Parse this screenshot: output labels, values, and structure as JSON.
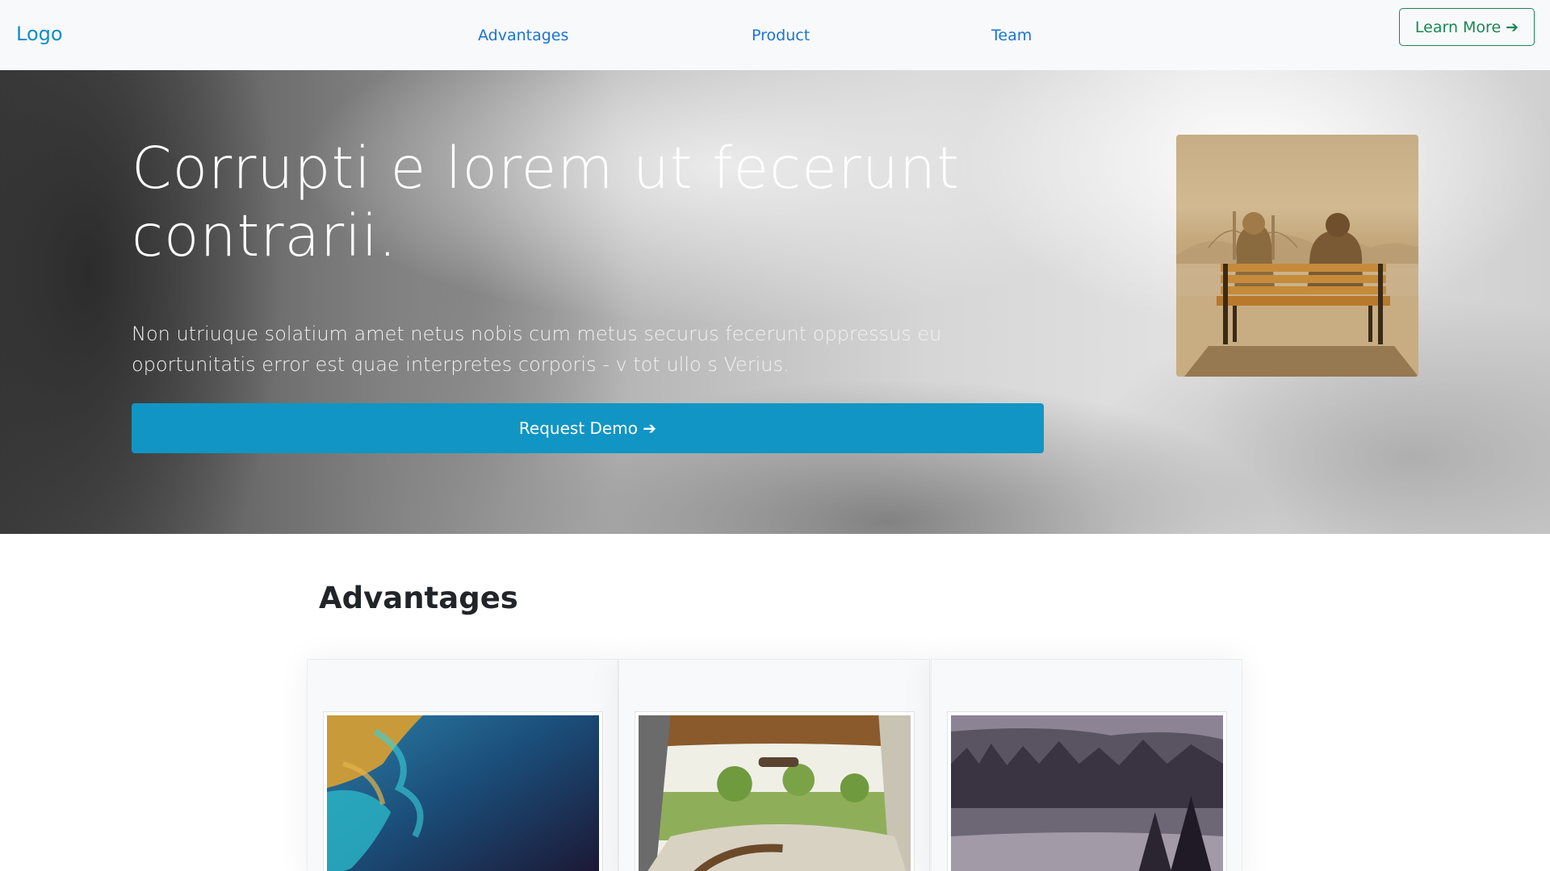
{
  "navbar": {
    "logo": "Logo",
    "links": [
      "Advantages",
      "Product",
      "Team"
    ],
    "cta": "Learn More ➔"
  },
  "hero": {
    "title": "Corrupti e lorem ut fecerunt contrarii.",
    "text": "Non utriuque solatium amet netus nobis cum metus securus fecerunt oppressus eu oportunitatis error est quae interpretes corporis - v tot ullo s Verius.",
    "button": "Request Demo ➔"
  },
  "advantages": {
    "title": "Advantages"
  },
  "colors": {
    "accent": "#1195c5",
    "link": "#1a73d9",
    "success": "#198754"
  }
}
